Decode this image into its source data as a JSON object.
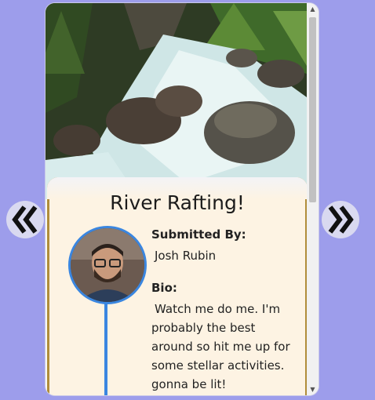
{
  "card": {
    "title": "River Rafting!",
    "submitted_by_label": "Submitted By:",
    "submitted_by": "Josh Rubin",
    "bio_label": "Bio:",
    "bio": "Watch me do me. I'm probably the best around so hit me up for some stellar activities. gonna be lit!"
  },
  "nav": {
    "prev_icon": "chevron-left-icon",
    "next_icon": "chevron-right-icon"
  },
  "colors": {
    "background": "#9d9deb",
    "panel": "#fdf3e3",
    "accent_blue": "#3a86e0",
    "panel_border": "#b08d3a"
  }
}
